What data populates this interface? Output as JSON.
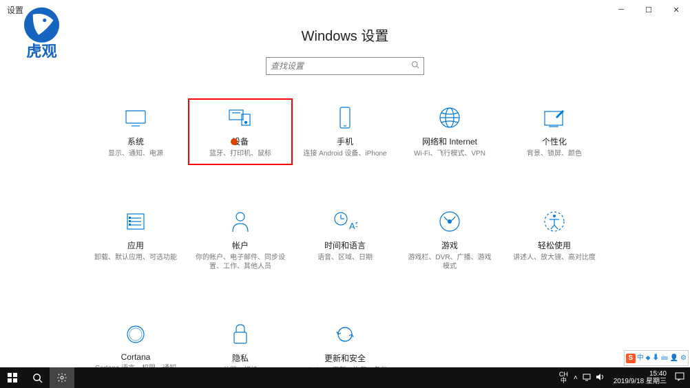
{
  "window": {
    "title": "设置"
  },
  "logo": {
    "text": "虎观"
  },
  "header": {
    "title": "Windows 设置"
  },
  "search": {
    "placeholder": "查找设置"
  },
  "tiles": [
    {
      "title": "系统",
      "desc": "显示、通知、电源"
    },
    {
      "title": "设备",
      "desc": "蓝牙、打印机、鼠标"
    },
    {
      "title": "手机",
      "desc": "连接 Android 设备、iPhone"
    },
    {
      "title": "网络和 Internet",
      "desc": "Wi-Fi、飞行模式、VPN"
    },
    {
      "title": "个性化",
      "desc": "背景、锁屏、颜色"
    },
    {
      "title": "应用",
      "desc": "卸载、默认应用、可选功能"
    },
    {
      "title": "帐户",
      "desc": "你的帐户、电子邮件、同步设置、工作、其他人员"
    },
    {
      "title": "时间和语言",
      "desc": "语音、区域、日期"
    },
    {
      "title": "游戏",
      "desc": "游戏栏、DVR、广播、游戏模式"
    },
    {
      "title": "轻松使用",
      "desc": "讲述人、放大镜、高对比度"
    },
    {
      "title": "Cortana",
      "desc": "Cortana 语言、权限、通知"
    },
    {
      "title": "隐私",
      "desc": "位置、相机"
    },
    {
      "title": "更新和安全",
      "desc": "Windows 更新、恢复、备份"
    }
  ],
  "taskbar": {
    "ime": {
      "lang": "CH",
      "layout": "中"
    },
    "clock": {
      "time": "15:40",
      "date": "2019/9/18 星期三"
    }
  },
  "ime_float": {
    "icon_letter": "S",
    "text": "中 ⬥ ⬇ 🖮 👤 ⚙"
  }
}
